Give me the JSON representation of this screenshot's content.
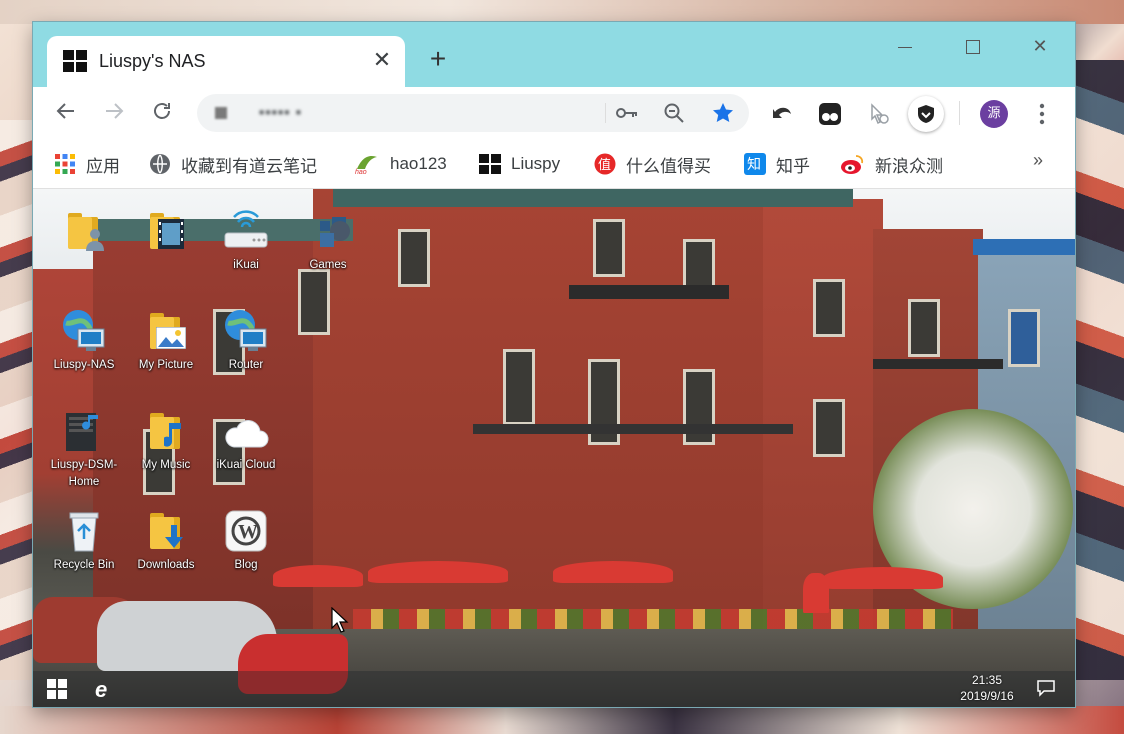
{
  "browser": {
    "tab_title": "Liuspy's NAS",
    "tab_close": "✕",
    "new_tab": "+",
    "address_text": "▪▪▪▪▪ ▪",
    "profile_initial": "源"
  },
  "bookmarks": [
    {
      "label": "应用",
      "icon": "apps-grid-icon"
    },
    {
      "label": "收藏到有道云笔记",
      "icon": "youdao-icon"
    },
    {
      "label": "hao123",
      "icon": "hao123-icon"
    },
    {
      "label": "Liuspy",
      "icon": "windows-icon"
    },
    {
      "label": "什么值得买",
      "icon": "smzdm-icon"
    },
    {
      "label": "知乎",
      "icon": "zhihu-icon"
    },
    {
      "label": "新浪众测",
      "icon": "weibo-icon"
    }
  ],
  "bookmarks_overflow": "»",
  "desktop": {
    "icons": [
      {
        "label": "",
        "kind": "user-folder"
      },
      {
        "label": "",
        "kind": "video-folder"
      },
      {
        "label": "iKuai",
        "kind": "router-wifi"
      },
      {
        "label": "Games",
        "kind": "gamepad"
      },
      {
        "label": "Liuspy-NAS",
        "kind": "network-globe"
      },
      {
        "label": "My Picture",
        "kind": "picture-folder"
      },
      {
        "label": "Router",
        "kind": "network-globe"
      },
      {
        "label": "Liuspy-DSM-Home",
        "kind": "dsm"
      },
      {
        "label": "My Music",
        "kind": "music-folder"
      },
      {
        "label": "iKuai Cloud",
        "kind": "cloud"
      },
      {
        "label": "Recycle Bin",
        "kind": "recycle-bin"
      },
      {
        "label": "Downloads",
        "kind": "download-folder"
      },
      {
        "label": "Blog",
        "kind": "wordpress"
      }
    ],
    "taskbar": {
      "time": "21:35",
      "date": "2019/9/16"
    }
  },
  "colors": {
    "titlebar": "#8fdbe3",
    "star": "#1a73e8",
    "profile": "#6b3fa0"
  }
}
